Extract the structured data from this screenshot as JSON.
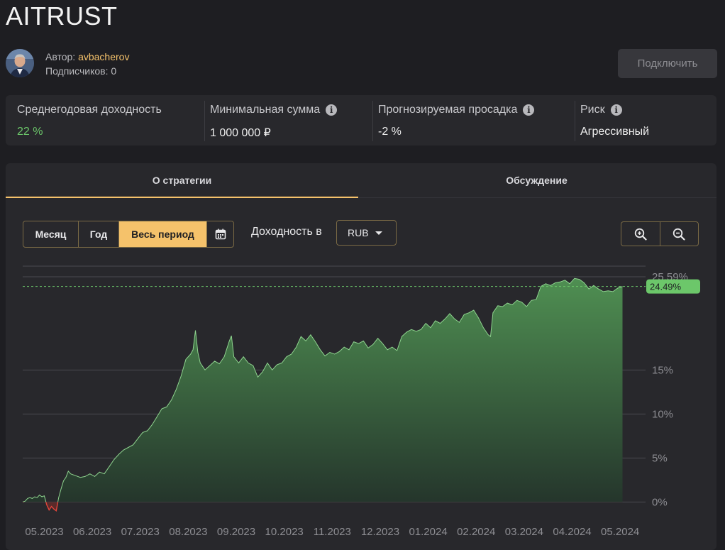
{
  "strategy": {
    "title": "AITRUST"
  },
  "author": {
    "prefix": "Автор: ",
    "name": "avbacherov",
    "subscribers_text": "Подписчиков: 0"
  },
  "connect_button": {
    "label": "Подключить"
  },
  "stats": {
    "annual": {
      "label": "Среднегодовая доходность",
      "value": "22 %"
    },
    "min_sum": {
      "label": "Минимальная сумма",
      "value": "1 000 000 ₽"
    },
    "drawdown": {
      "label": "Прогнозируемая просадка",
      "value": "-2 %"
    },
    "risk": {
      "label": "Риск",
      "value": "Агрессивный"
    }
  },
  "tabs": {
    "about": "О стратегии",
    "discussion": "Обсуждение"
  },
  "controls": {
    "periods": [
      "Месяц",
      "Год",
      "Весь период"
    ],
    "active_period": "Весь период",
    "yield_label": "Доходность в",
    "currency": "RUB"
  },
  "colors": {
    "accent": "#f5c26b",
    "positive": "#6cc76a",
    "negative": "#e0443a"
  },
  "chart_data": {
    "type": "area",
    "x_ticks": [
      "05.2023",
      "06.2023",
      "07.2023",
      "08.2023",
      "09.2023",
      "10.2023",
      "11.2023",
      "12.2023",
      "01.2024",
      "02.2024",
      "03.2024",
      "04.2024",
      "05.2024"
    ],
    "y_ticks": [
      {
        "value": 0,
        "label": "0%"
      },
      {
        "value": 5,
        "label": "5%"
      },
      {
        "value": 10,
        "label": "10%"
      },
      {
        "value": 15,
        "label": "15%"
      },
      {
        "value": 25.59,
        "label": "25.59%"
      }
    ],
    "current": {
      "value": 24.49,
      "label": "24.49%"
    },
    "ylim": [
      -1.5,
      27.2
    ],
    "xlim": [
      0,
      12.98
    ],
    "grid": true,
    "points": [
      [
        0,
        0
      ],
      [
        0.05,
        0.1
      ],
      [
        0.1,
        0.4
      ],
      [
        0.15,
        0.5
      ],
      [
        0.2,
        0.4
      ],
      [
        0.25,
        0.6
      ],
      [
        0.3,
        0.5
      ],
      [
        0.35,
        0.8
      ],
      [
        0.4,
        0.6
      ],
      [
        0.45,
        0.7
      ],
      [
        0.5,
        -0.3
      ],
      [
        0.55,
        -0.9
      ],
      [
        0.6,
        -0.5
      ],
      [
        0.65,
        -0.8
      ],
      [
        0.7,
        -1.0
      ],
      [
        0.75,
        0.5
      ],
      [
        0.8,
        1.5
      ],
      [
        0.85,
        2.4
      ],
      [
        0.9,
        2.8
      ],
      [
        0.95,
        3.5
      ],
      [
        1,
        3.2
      ],
      [
        1.1,
        3.0
      ],
      [
        1.2,
        2.8
      ],
      [
        1.3,
        2.9
      ],
      [
        1.4,
        3.2
      ],
      [
        1.5,
        2.9
      ],
      [
        1.6,
        3.4
      ],
      [
        1.7,
        3.2
      ],
      [
        1.8,
        4.0
      ],
      [
        1.9,
        4.8
      ],
      [
        2,
        5.4
      ],
      [
        2.1,
        5.9
      ],
      [
        2.2,
        6.2
      ],
      [
        2.3,
        6.5
      ],
      [
        2.4,
        7.2
      ],
      [
        2.5,
        7.9
      ],
      [
        2.6,
        8.1
      ],
      [
        2.7,
        8.8
      ],
      [
        2.8,
        9.7
      ],
      [
        2.9,
        10.6
      ],
      [
        3,
        10.8
      ],
      [
        3.1,
        11.6
      ],
      [
        3.2,
        12.8
      ],
      [
        3.3,
        14.3
      ],
      [
        3.4,
        16.2
      ],
      [
        3.5,
        16.8
      ],
      [
        3.55,
        17.3
      ],
      [
        3.6,
        19.5
      ],
      [
        3.65,
        17.0
      ],
      [
        3.7,
        15.8
      ],
      [
        3.8,
        15.0
      ],
      [
        3.9,
        15.5
      ],
      [
        4,
        16.0
      ],
      [
        4.1,
        15.7
      ],
      [
        4.2,
        16.5
      ],
      [
        4.3,
        18.2
      ],
      [
        4.35,
        18.9
      ],
      [
        4.4,
        16.5
      ],
      [
        4.5,
        15.8
      ],
      [
        4.6,
        16.5
      ],
      [
        4.7,
        15.8
      ],
      [
        4.8,
        15.5
      ],
      [
        4.9,
        14.2
      ],
      [
        5,
        14.8
      ],
      [
        5.1,
        15.8
      ],
      [
        5.2,
        15.0
      ],
      [
        5.3,
        15.6
      ],
      [
        5.4,
        15.8
      ],
      [
        5.5,
        16.5
      ],
      [
        5.6,
        16.8
      ],
      [
        5.7,
        17.6
      ],
      [
        5.8,
        18.8
      ],
      [
        5.9,
        18.3
      ],
      [
        6,
        19.0
      ],
      [
        6.1,
        18.2
      ],
      [
        6.2,
        17.3
      ],
      [
        6.3,
        16.6
      ],
      [
        6.4,
        17.0
      ],
      [
        6.5,
        16.8
      ],
      [
        6.6,
        17.1
      ],
      [
        6.7,
        17.6
      ],
      [
        6.8,
        17.3
      ],
      [
        6.9,
        18.2
      ],
      [
        7,
        18.0
      ],
      [
        7.1,
        18.3
      ],
      [
        7.2,
        17.5
      ],
      [
        7.3,
        17.9
      ],
      [
        7.4,
        18.6
      ],
      [
        7.5,
        18.0
      ],
      [
        7.6,
        17.3
      ],
      [
        7.7,
        17.6
      ],
      [
        7.8,
        17.2
      ],
      [
        7.9,
        18.8
      ],
      [
        8,
        19.3
      ],
      [
        8.1,
        19.6
      ],
      [
        8.2,
        19.4
      ],
      [
        8.3,
        19.6
      ],
      [
        8.4,
        20.3
      ],
      [
        8.5,
        19.8
      ],
      [
        8.6,
        20.6
      ],
      [
        8.7,
        20.3
      ],
      [
        8.8,
        20.8
      ],
      [
        8.9,
        21.4
      ],
      [
        9,
        20.8
      ],
      [
        9.1,
        20.4
      ],
      [
        9.2,
        21.3
      ],
      [
        9.3,
        21.5
      ],
      [
        9.4,
        21.8
      ],
      [
        9.5,
        20.9
      ],
      [
        9.6,
        19.8
      ],
      [
        9.7,
        19.0
      ],
      [
        9.75,
        18.8
      ],
      [
        9.8,
        21.5
      ],
      [
        9.9,
        22.3
      ],
      [
        10,
        22.2
      ],
      [
        10.1,
        22.6
      ],
      [
        10.2,
        22.4
      ],
      [
        10.3,
        22.9
      ],
      [
        10.4,
        22.7
      ],
      [
        10.5,
        22.2
      ],
      [
        10.6,
        22.9
      ],
      [
        10.7,
        23.0
      ],
      [
        10.8,
        24.5
      ],
      [
        10.9,
        24.8
      ],
      [
        11,
        24.6
      ],
      [
        11.1,
        24.9
      ],
      [
        11.2,
        25.0
      ],
      [
        11.3,
        25.2
      ],
      [
        11.4,
        24.8
      ],
      [
        11.5,
        25.4
      ],
      [
        11.6,
        25.3
      ],
      [
        11.7,
        24.9
      ],
      [
        11.8,
        24.2
      ],
      [
        11.9,
        24.6
      ],
      [
        12,
        24.2
      ],
      [
        12.1,
        23.9
      ],
      [
        12.2,
        24.0
      ],
      [
        12.3,
        23.9
      ],
      [
        12.4,
        24.3
      ],
      [
        12.5,
        24.49
      ]
    ]
  }
}
